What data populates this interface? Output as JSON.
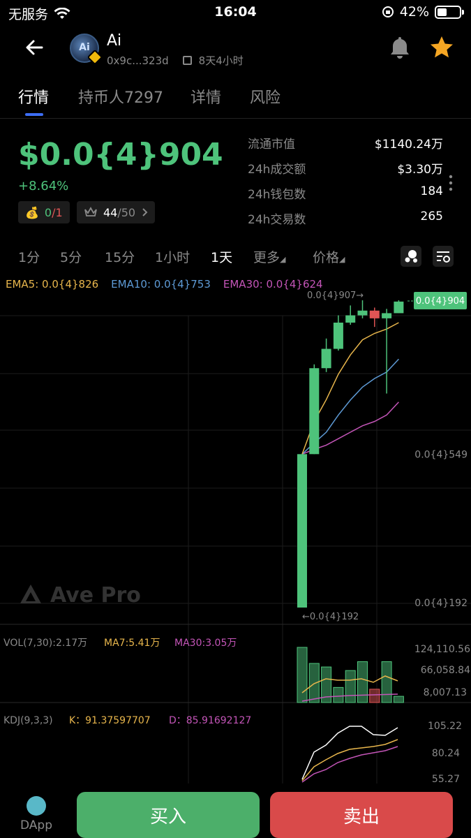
{
  "status_bar": {
    "carrier": "无服务",
    "time": "16:04",
    "battery": "42%",
    "battery_level": 0.42
  },
  "header": {
    "token_name": "Ai",
    "address": "0x9c...323d",
    "age": "8天4小时"
  },
  "tabs": [
    {
      "label": "行情",
      "active": true
    },
    {
      "label": "持币人7297",
      "active": false
    },
    {
      "label": "详情",
      "active": false
    },
    {
      "label": "风险",
      "active": false
    }
  ],
  "price": {
    "value": "$0.0{4}904",
    "change": "+8.64%",
    "badge1_value": "0",
    "badge1_total": "/1",
    "badge2_value": "44",
    "badge2_total": "/50"
  },
  "stats": [
    {
      "label": "流通市值",
      "value": "$1140.24万"
    },
    {
      "label": "24h成交额",
      "value": "$3.30万"
    },
    {
      "label": "24h钱包数",
      "value": "184"
    },
    {
      "label": "24h交易数",
      "value": "265"
    }
  ],
  "intervals": [
    {
      "label": "1分",
      "active": false
    },
    {
      "label": "5分",
      "active": false
    },
    {
      "label": "15分",
      "active": false
    },
    {
      "label": "1小时",
      "active": false
    },
    {
      "label": "1天",
      "active": true
    },
    {
      "label": "更多",
      "active": false
    },
    {
      "label": "价格",
      "active": false
    }
  ],
  "ema_legend": {
    "ema5": "EMA5: 0.0{4}826",
    "ema10": "EMA10: 0.0{4}753",
    "ema30": "EMA30: 0.0{4}624"
  },
  "colors": {
    "up": "#4ec37b",
    "down": "#e05555",
    "ema5": "#e8b64c",
    "ema10": "#5e9bd6",
    "ema30": "#c455b8",
    "accent": "#3d6ef5"
  },
  "chart_data": {
    "type": "candlestick",
    "price_axis_labels": [
      "0.0{4}549",
      "0.0{4}192"
    ],
    "current_price_label": "0.0{4}904",
    "high_marker": "0.0{4}907→",
    "low_marker": "←0.0{4}192",
    "candles": [
      {
        "open": 192,
        "close": 549,
        "high": 549,
        "low": 192,
        "dir": "up"
      },
      {
        "open": 549,
        "close": 749,
        "high": 758,
        "low": 549,
        "dir": "up"
      },
      {
        "open": 749,
        "close": 794,
        "high": 818,
        "low": 740,
        "dir": "up"
      },
      {
        "open": 794,
        "close": 855,
        "high": 872,
        "low": 790,
        "dir": "up"
      },
      {
        "open": 855,
        "close": 872,
        "high": 895,
        "low": 850,
        "dir": "up"
      },
      {
        "open": 872,
        "close": 883,
        "high": 907,
        "low": 865,
        "dir": "up"
      },
      {
        "open": 883,
        "close": 865,
        "high": 890,
        "low": 845,
        "dir": "down"
      },
      {
        "open": 865,
        "close": 877,
        "high": 887,
        "low": 690,
        "dir": "up"
      },
      {
        "open": 877,
        "close": 904,
        "high": 907,
        "low": 877,
        "dir": "up"
      }
    ],
    "ema5": [
      549,
      625,
      676,
      735,
      780,
      815,
      830,
      840,
      855
    ],
    "ema10": [
      549,
      575,
      600,
      640,
      675,
      705,
      725,
      740,
      770
    ],
    "ema30": [
      549,
      560,
      570,
      585,
      600,
      615,
      625,
      640,
      670
    ],
    "volume": {
      "legend": "VOL(7,30):2.17万",
      "ma7": "MA7:5.41万",
      "ma30": "MA30:3.05万",
      "axis_labels": [
        "124,110.56",
        "66,058.84",
        "8,007.13"
      ],
      "bars": [
        {
          "value": 124110,
          "dir": "up"
        },
        {
          "value": 88000,
          "dir": "up"
        },
        {
          "value": 80000,
          "dir": "up"
        },
        {
          "value": 34000,
          "dir": "up"
        },
        {
          "value": 72000,
          "dir": "up"
        },
        {
          "value": 92000,
          "dir": "up"
        },
        {
          "value": 30000,
          "dir": "down"
        },
        {
          "value": 92000,
          "dir": "up"
        },
        {
          "value": 14000,
          "dir": "up"
        }
      ]
    },
    "kdj": {
      "legend": "KDJ(9,3,3)",
      "k": "K：91.37597707",
      "d": "D：85.91692127",
      "axis_labels": [
        "105.22",
        "80.24",
        "55.27"
      ]
    }
  },
  "watermark": "Ave Pro",
  "bottom": {
    "dapp": "DApp",
    "buy": "买入",
    "sell": "卖出"
  }
}
